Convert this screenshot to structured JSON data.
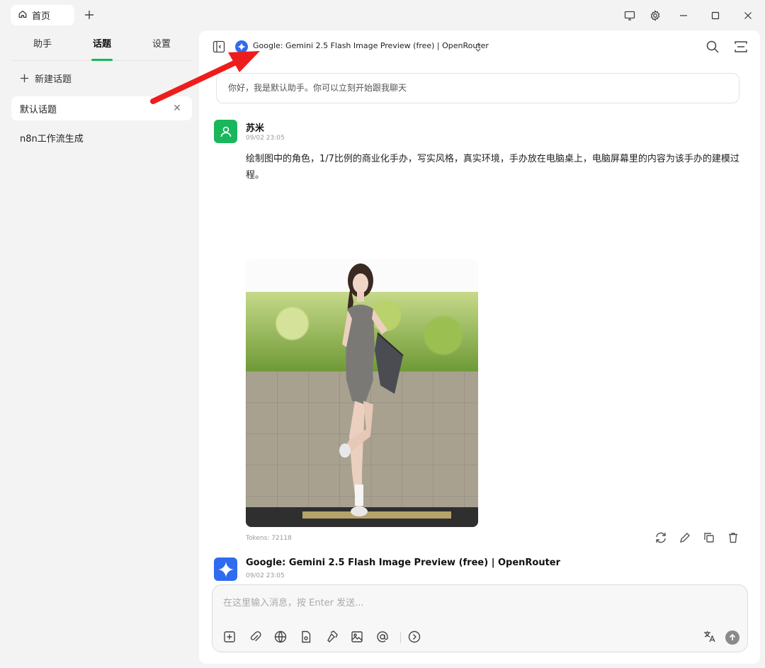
{
  "titlebar": {
    "home_tab_label": "首页",
    "icons": [
      "home-icon",
      "add-icon",
      "monitor-icon",
      "gear-icon",
      "minimize-icon",
      "maximize-icon",
      "close-icon"
    ]
  },
  "left_panel": {
    "tabs": [
      {
        "label": "助手",
        "active": false
      },
      {
        "label": "话题",
        "active": true
      },
      {
        "label": "设置",
        "active": false
      }
    ],
    "new_topic_label": "新建话题",
    "topics": [
      {
        "label": "默认话题",
        "selected": true
      },
      {
        "label": "n8n工作流生成",
        "selected": false
      }
    ],
    "accent_color": "#19b65c"
  },
  "header": {
    "model_name": "Google: Gemini 2.5 Flash Image Preview (free) | OpenRouter",
    "model_badge_color": "#2f6bef"
  },
  "chat": {
    "greeting": "你好，我是默认助手。你可以立刻开始跟我聊天",
    "messages": [
      {
        "sender": "苏米",
        "time": "09/02 23:05",
        "avatar_color": "#19b65c",
        "text": "绘制图中的角色，1/7比例的商业化手办，写实风格，真实环境，手办放在电脑桌上，电脑屏幕里的内容为该手办的建模过程。",
        "tokens": "Tokens: 72118"
      },
      {
        "sender": "Google: Gemini 2.5 Flash Image Preview (free) | OpenRouter",
        "time": "09/02 23:05",
        "avatar_color": "#2f6bef"
      }
    ]
  },
  "composer": {
    "placeholder": "在这里输入消息，按 Enter 发送...",
    "value": ""
  }
}
